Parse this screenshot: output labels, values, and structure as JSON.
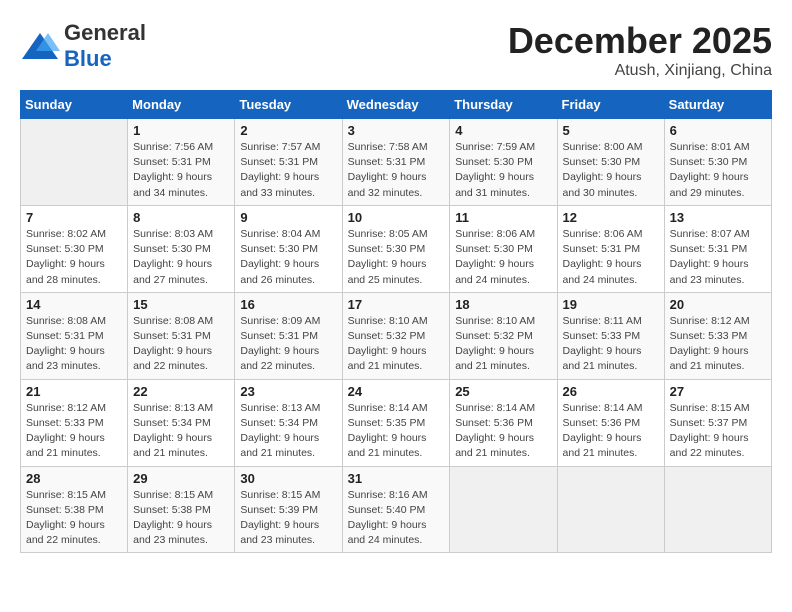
{
  "header": {
    "logo_general": "General",
    "logo_blue": "Blue",
    "month": "December 2025",
    "location": "Atush, Xinjiang, China"
  },
  "weekdays": [
    "Sunday",
    "Monday",
    "Tuesday",
    "Wednesday",
    "Thursday",
    "Friday",
    "Saturday"
  ],
  "weeks": [
    [
      {
        "day": "",
        "info": ""
      },
      {
        "day": "1",
        "info": "Sunrise: 7:56 AM\nSunset: 5:31 PM\nDaylight: 9 hours\nand 34 minutes."
      },
      {
        "day": "2",
        "info": "Sunrise: 7:57 AM\nSunset: 5:31 PM\nDaylight: 9 hours\nand 33 minutes."
      },
      {
        "day": "3",
        "info": "Sunrise: 7:58 AM\nSunset: 5:31 PM\nDaylight: 9 hours\nand 32 minutes."
      },
      {
        "day": "4",
        "info": "Sunrise: 7:59 AM\nSunset: 5:30 PM\nDaylight: 9 hours\nand 31 minutes."
      },
      {
        "day": "5",
        "info": "Sunrise: 8:00 AM\nSunset: 5:30 PM\nDaylight: 9 hours\nand 30 minutes."
      },
      {
        "day": "6",
        "info": "Sunrise: 8:01 AM\nSunset: 5:30 PM\nDaylight: 9 hours\nand 29 minutes."
      }
    ],
    [
      {
        "day": "7",
        "info": ""
      },
      {
        "day": "8",
        "info": "Sunrise: 8:03 AM\nSunset: 5:30 PM\nDaylight: 9 hours\nand 27 minutes."
      },
      {
        "day": "9",
        "info": "Sunrise: 8:04 AM\nSunset: 5:30 PM\nDaylight: 9 hours\nand 26 minutes."
      },
      {
        "day": "10",
        "info": "Sunrise: 8:05 AM\nSunset: 5:30 PM\nDaylight: 9 hours\nand 25 minutes."
      },
      {
        "day": "11",
        "info": "Sunrise: 8:06 AM\nSunset: 5:30 PM\nDaylight: 9 hours\nand 24 minutes."
      },
      {
        "day": "12",
        "info": "Sunrise: 8:06 AM\nSunset: 5:31 PM\nDaylight: 9 hours\nand 24 minutes."
      },
      {
        "day": "13",
        "info": "Sunrise: 8:07 AM\nSunset: 5:31 PM\nDaylight: 9 hours\nand 23 minutes."
      }
    ],
    [
      {
        "day": "14",
        "info": ""
      },
      {
        "day": "15",
        "info": "Sunrise: 8:08 AM\nSunset: 5:31 PM\nDaylight: 9 hours\nand 22 minutes."
      },
      {
        "day": "16",
        "info": "Sunrise: 8:09 AM\nSunset: 5:31 PM\nDaylight: 9 hours\nand 22 minutes."
      },
      {
        "day": "17",
        "info": "Sunrise: 8:10 AM\nSunset: 5:32 PM\nDaylight: 9 hours\nand 21 minutes."
      },
      {
        "day": "18",
        "info": "Sunrise: 8:10 AM\nSunset: 5:32 PM\nDaylight: 9 hours\nand 21 minutes."
      },
      {
        "day": "19",
        "info": "Sunrise: 8:11 AM\nSunset: 5:33 PM\nDaylight: 9 hours\nand 21 minutes."
      },
      {
        "day": "20",
        "info": "Sunrise: 8:12 AM\nSunset: 5:33 PM\nDaylight: 9 hours\nand 21 minutes."
      }
    ],
    [
      {
        "day": "21",
        "info": ""
      },
      {
        "day": "22",
        "info": "Sunrise: 8:13 AM\nSunset: 5:34 PM\nDaylight: 9 hours\nand 21 minutes."
      },
      {
        "day": "23",
        "info": "Sunrise: 8:13 AM\nSunset: 5:34 PM\nDaylight: 9 hours\nand 21 minutes."
      },
      {
        "day": "24",
        "info": "Sunrise: 8:14 AM\nSunset: 5:35 PM\nDaylight: 9 hours\nand 21 minutes."
      },
      {
        "day": "25",
        "info": "Sunrise: 8:14 AM\nSunset: 5:36 PM\nDaylight: 9 hours\nand 21 minutes."
      },
      {
        "day": "26",
        "info": "Sunrise: 8:14 AM\nSunset: 5:36 PM\nDaylight: 9 hours\nand 21 minutes."
      },
      {
        "day": "27",
        "info": "Sunrise: 8:15 AM\nSunset: 5:37 PM\nDaylight: 9 hours\nand 22 minutes."
      }
    ],
    [
      {
        "day": "28",
        "info": "Sunrise: 8:15 AM\nSunset: 5:38 PM\nDaylight: 9 hours\nand 22 minutes."
      },
      {
        "day": "29",
        "info": "Sunrise: 8:15 AM\nSunset: 5:38 PM\nDaylight: 9 hours\nand 23 minutes."
      },
      {
        "day": "30",
        "info": "Sunrise: 8:15 AM\nSunset: 5:39 PM\nDaylight: 9 hours\nand 23 minutes."
      },
      {
        "day": "31",
        "info": "Sunrise: 8:16 AM\nSunset: 5:40 PM\nDaylight: 9 hours\nand 24 minutes."
      },
      {
        "day": "",
        "info": ""
      },
      {
        "day": "",
        "info": ""
      },
      {
        "day": "",
        "info": ""
      }
    ]
  ],
  "week7_day7_info": "Sunrise: 8:02 AM\nSunset: 5:30 PM\nDaylight: 9 hours\nand 28 minutes.",
  "week14_day14_info": "Sunrise: 8:08 AM\nSunset: 5:31 PM\nDaylight: 9 hours\nand 23 minutes.",
  "week21_day21_info": "Sunrise: 8:12 AM\nSunset: 5:33 PM\nDaylight: 9 hours\nand 21 minutes."
}
